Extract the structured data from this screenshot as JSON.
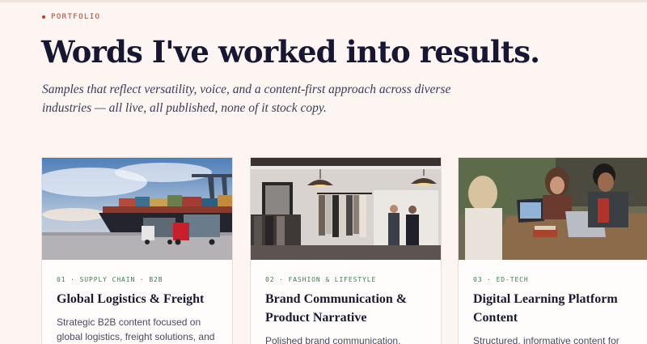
{
  "section": {
    "eyebrow": "PORTFOLIO",
    "headline": "Words I've worked into results.",
    "subtitle": "Samples that reflect versatility, voice, and a content-first approach across diverse industries — all live, all published, none of it stock copy."
  },
  "cards": [
    {
      "meta": "01 · SUPPLY CHAIN · B2B",
      "title": "Global Logistics & Freight",
      "description": "Strategic B2B content focused on global logistics, freight solutions, and",
      "image": "cargo-ship-and-trucks-photo"
    },
    {
      "meta": "02 · FASHION & LIFESTYLE",
      "title": "Brand Communication & Product Narrative",
      "description": "Polished brand communication,",
      "image": "clothing-boutique-photo"
    },
    {
      "meta": "03 · ED-TECH",
      "title": "Digital Learning Platform Content",
      "description": "Structured, informative content for",
      "image": "students-with-laptops-photo"
    }
  ],
  "colors": {
    "background": "#fcf5f1",
    "accent": "#c0392b",
    "meta_green": "#3f7a54",
    "heading": "#181733"
  }
}
